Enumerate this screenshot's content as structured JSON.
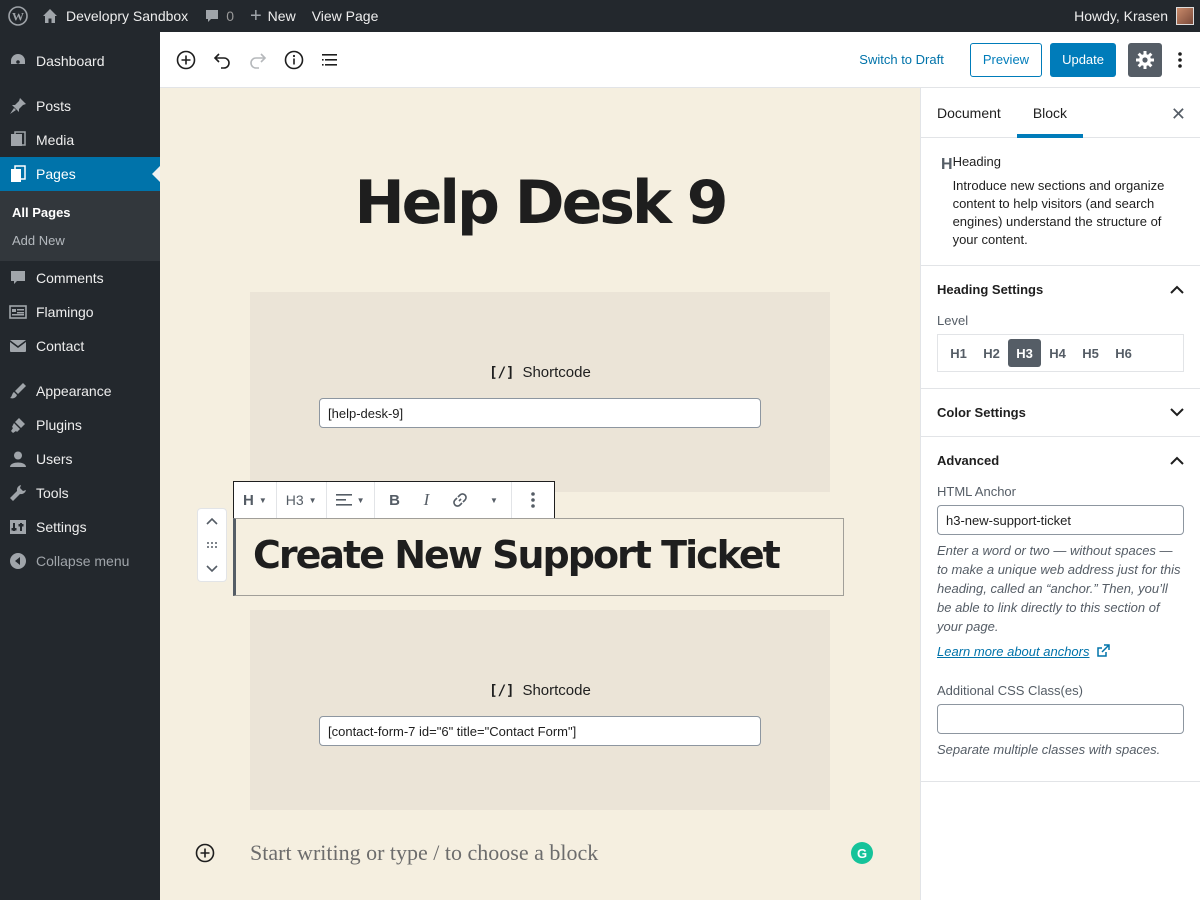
{
  "adminbar": {
    "site_name": "Developry Sandbox",
    "comments_count": "0",
    "new_label": "New",
    "view_page": "View Page",
    "greeting": "Howdy, Krasen"
  },
  "sidebar": {
    "items": [
      {
        "label": "Dashboard",
        "icon": "dashboard-icon"
      },
      {
        "label": "Posts",
        "icon": "pin-icon"
      },
      {
        "label": "Media",
        "icon": "media-icon"
      },
      {
        "label": "Pages",
        "icon": "pages-icon"
      },
      {
        "label": "Comments",
        "icon": "comment-icon"
      },
      {
        "label": "Flamingo",
        "icon": "flamingo-icon"
      },
      {
        "label": "Contact",
        "icon": "mail-icon"
      },
      {
        "label": "Appearance",
        "icon": "brush-icon"
      },
      {
        "label": "Plugins",
        "icon": "plugin-icon"
      },
      {
        "label": "Users",
        "icon": "user-icon"
      },
      {
        "label": "Tools",
        "icon": "wrench-icon"
      },
      {
        "label": "Settings",
        "icon": "settings-icon"
      }
    ],
    "submenu": [
      "All Pages",
      "Add New"
    ],
    "collapse": "Collapse menu"
  },
  "header": {
    "switch_draft": "Switch to Draft",
    "preview": "Preview",
    "update": "Update"
  },
  "canvas": {
    "page_title": "Help Desk 9",
    "shortcode_label": "Shortcode",
    "shortcode_icon_text": "[/]",
    "shortcode_1": "[help-desk-9]",
    "heading": "Create New Support Ticket",
    "shortcode_2": "[contact-form-7 id=\"6\" title=\"Contact Form\"]",
    "appender_placeholder": "Start writing or type / to choose a block",
    "toolbar": {
      "block_type": "H",
      "level": "H3"
    }
  },
  "settings": {
    "tabs": [
      "Document",
      "Block"
    ],
    "active_tab": "Block",
    "block": {
      "icon_text": "H",
      "title": "Heading",
      "description": "Introduce new sections and organize content to help visitors (and search engines) understand the structure of your content."
    },
    "heading_settings": {
      "title": "Heading Settings",
      "level_label": "Level",
      "levels": [
        "H1",
        "H2",
        "H3",
        "H4",
        "H5",
        "H6"
      ],
      "selected": "H3"
    },
    "color_settings": {
      "title": "Color Settings"
    },
    "advanced": {
      "title": "Advanced",
      "anchor_label": "HTML Anchor",
      "anchor_value": "h3-new-support-ticket",
      "anchor_help": "Enter a word or two — without spaces — to make a unique web address just for this heading, called an “anchor.” Then, you’ll be able to link directly to this section of your page.",
      "learn_more": "Learn more about anchors",
      "css_label": "Additional CSS Class(es)",
      "css_value": "",
      "css_help": "Separate multiple classes with spaces."
    }
  },
  "colors": {
    "accent": "#007cba",
    "admin_bg": "#23282d",
    "canvas_bg": "#f5efe0",
    "block_bg": "#ebe4d7"
  }
}
